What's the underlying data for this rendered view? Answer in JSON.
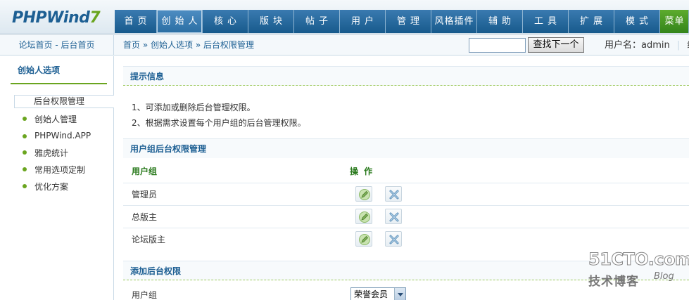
{
  "header": {
    "logo_main": "PHPWind",
    "logo_seven": "7",
    "nav": [
      {
        "label": "首页",
        "active": false
      },
      {
        "label": "创始人",
        "active": true
      },
      {
        "label": "核心",
        "active": false
      },
      {
        "label": "版块",
        "active": false
      },
      {
        "label": "帖子",
        "active": false
      },
      {
        "label": "用户",
        "active": false
      },
      {
        "label": "管理",
        "active": false
      },
      {
        "label": "风格插件",
        "active": false
      },
      {
        "label": "辅助",
        "active": false
      },
      {
        "label": "工具",
        "active": false
      },
      {
        "label": "扩展",
        "active": false
      },
      {
        "label": "模式",
        "active": false
      },
      {
        "label": "菜单",
        "active": false
      }
    ]
  },
  "subbar": {
    "left_links": "论坛首页 - 后台首页",
    "breadcrumb": [
      "首页",
      "创始人选项",
      "后台权限管理"
    ],
    "breadcrumb_sep": "»",
    "search_value": "",
    "find_button": "查找下一个",
    "user_label": "用户名：admin",
    "user_extra": "级"
  },
  "sidebar": {
    "title": "创始人选项",
    "active_item": "后台权限管理",
    "items": [
      "创始人管理",
      "PHPWind.APP",
      "雅虎统计",
      "常用选项定制",
      "优化方案"
    ]
  },
  "content": {
    "tips_title": "提示信息",
    "tips": [
      "1、可添加或删除后台管理权限。",
      "2、根据需求设置每个用户组的后台管理权限。"
    ],
    "table_title": "用户组后台权限管理",
    "columns": [
      "用户组",
      "操 作"
    ],
    "rows": [
      {
        "group": "管理员"
      },
      {
        "group": "总版主"
      },
      {
        "group": "论坛版主"
      }
    ],
    "add_title": "添加后台权限",
    "add_label": "用户组",
    "add_select_value": "荣誉会员"
  },
  "watermark": {
    "big": "51CTO.com",
    "small": "技术博客",
    "blog": "Blog"
  },
  "colors": {
    "nav_blue": "#1d5f93",
    "accent_green": "#6aa51f",
    "header_green": "#2a7a1d"
  }
}
